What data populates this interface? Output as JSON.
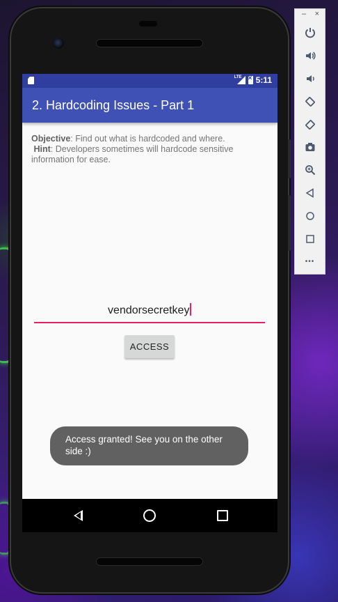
{
  "statusbar": {
    "time": "5:11",
    "network": "LTE"
  },
  "app": {
    "title": "2. Hardcoding Issues - Part 1"
  },
  "content": {
    "objective_label": "Objective",
    "objective_text": ": Find out what is hardcoded and where.",
    "hint_label": "Hint",
    "hint_text": ": Developers sometimes will hardcode sensitive information for ease."
  },
  "input": {
    "value": "vendorsecretkey"
  },
  "button": {
    "label": "ACCESS"
  },
  "toast": {
    "text": "Access granted! See you on the other side :)"
  },
  "toolbar": {
    "minimize": "–",
    "close": "×",
    "items": [
      "power-icon",
      "volume-up-icon",
      "volume-down-icon",
      "rotate-left-icon",
      "rotate-right-icon",
      "camera-icon",
      "zoom-icon",
      "back-icon",
      "home-icon",
      "overview-icon",
      "more-icon"
    ],
    "more": "•••"
  },
  "colors": {
    "primary": "#3f51b5",
    "primary_dark": "#303f9f",
    "accent": "#e91e63",
    "toast": "#616161"
  }
}
